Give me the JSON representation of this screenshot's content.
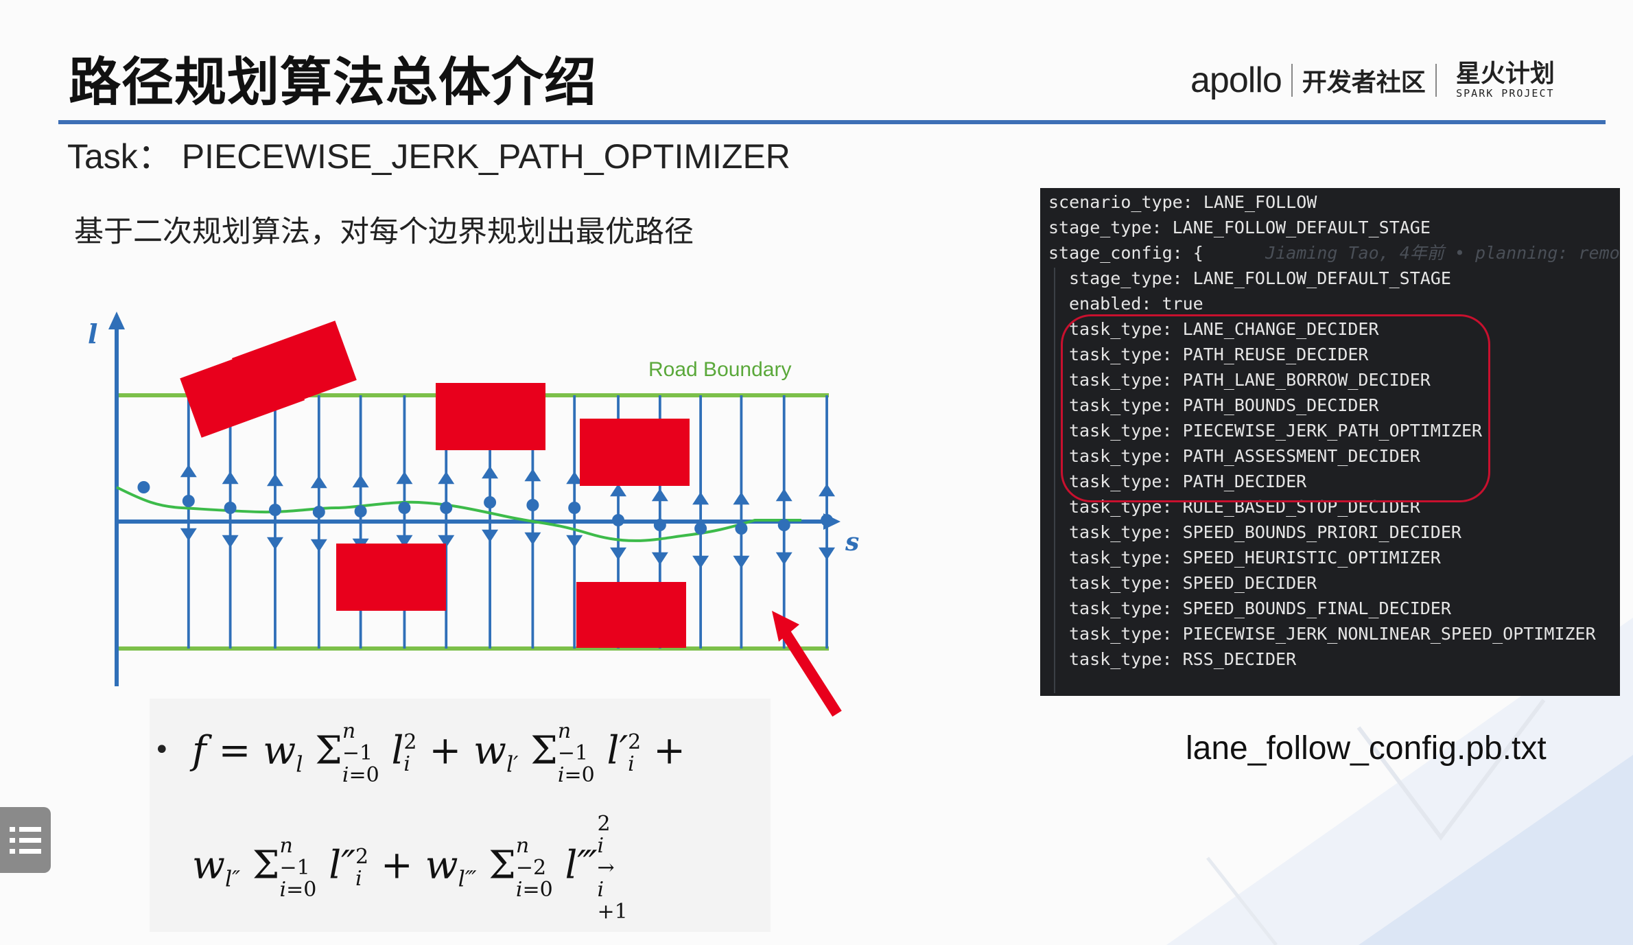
{
  "slide": {
    "title": "路径规划算法总体介绍",
    "logo": {
      "apollo": "apollo",
      "community": "开发者社区",
      "spark_cn": "星火计划",
      "spark_en": "SPARK PROJECT"
    },
    "task_line": "Task：  PIECEWISE_JERK_PATH_OPTIMIZER",
    "description": "基于二次规划算法，对每个边界规划出最优路径",
    "diagram": {
      "axis_l": "l",
      "axis_s": "s",
      "road_boundary": "Road Boundary"
    },
    "formula": {
      "bullet": "•",
      "line1": "f = w_l Σ_{i=0}^{n-1} l_i^2 + w_{l'} Σ_{i=0}^{n-1} l_i'^2 +",
      "line2": "w_{l''} Σ_{i=0}^{n-1} l_i''^2 + w_{l'''} Σ_{i=0}^{n-2} l'''_{i→i+1}^2"
    },
    "config": {
      "lines": [
        "scenario_type: LANE_FOLLOW",
        "stage_type: LANE_FOLLOW_DEFAULT_STAGE",
        "stage_config: {",
        "stage_type: LANE_FOLLOW_DEFAULT_STAGE",
        "enabled: true",
        "task_type: LANE_CHANGE_DECIDER",
        "task_type: PATH_REUSE_DECIDER",
        "task_type: PATH_LANE_BORROW_DECIDER",
        "task_type: PATH_BOUNDS_DECIDER",
        "task_type: PIECEWISE_JERK_PATH_OPTIMIZER",
        "task_type: PATH_ASSESSMENT_DECIDER",
        "task_type: PATH_DECIDER",
        "task_type: RULE_BASED_STOP_DECIDER",
        "task_type: SPEED_BOUNDS_PRIORI_DECIDER",
        "task_type: SPEED_HEURISTIC_OPTIMIZER",
        "task_type: SPEED_DECIDER",
        "task_type: SPEED_BOUNDS_FINAL_DECIDER",
        "task_type: PIECEWISE_JERK_NONLINEAR_SPEED_OPTIMIZER",
        "task_type: RSS_DECIDER"
      ],
      "blame": "Jiaming Tao, 4年前 • planning: remo"
    },
    "caption": "lane_follow_config.pb.txt"
  },
  "colors": {
    "header_line": "#3d6fb5",
    "axis": "#2f6fb8",
    "boundary": "#7cc04a",
    "obstacle": "#e8001c",
    "path": "#3dbb4a",
    "highlight": "#c8102e"
  },
  "icons": {
    "menu": "menu-list-icon"
  }
}
